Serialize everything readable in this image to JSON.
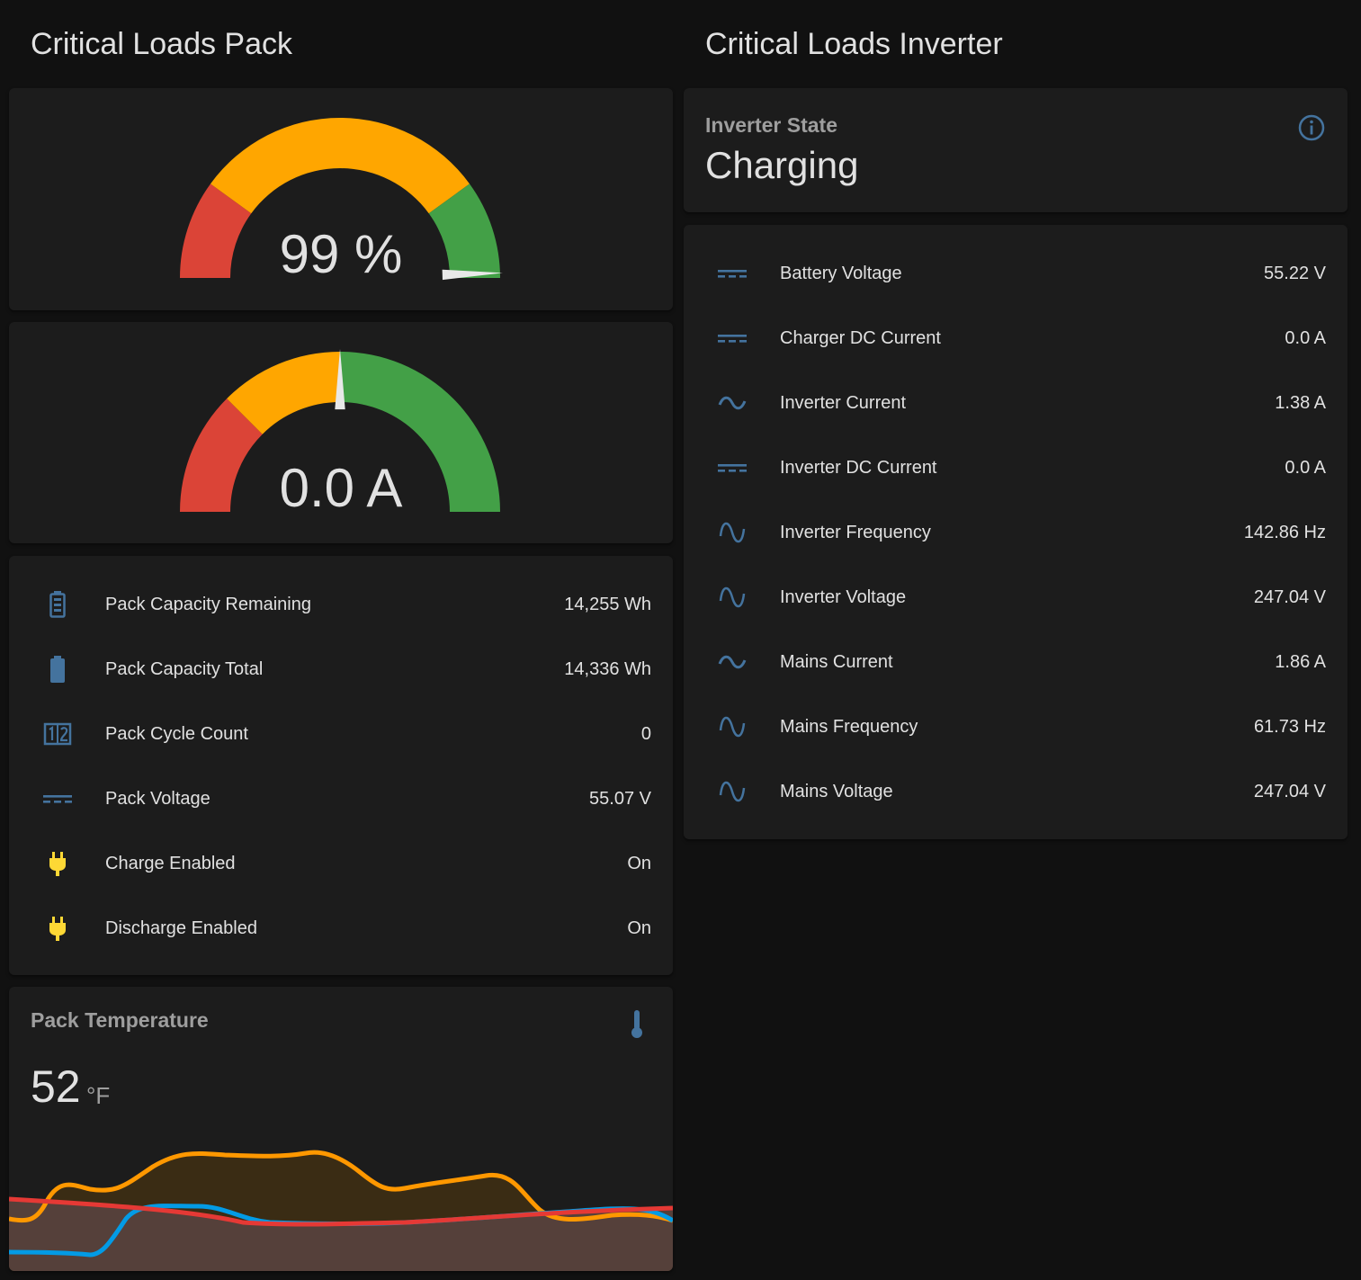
{
  "pack": {
    "title": "Critical Loads Pack",
    "soc_gauge": {
      "value_text": "99 %",
      "value": 99,
      "min": 0,
      "max": 100,
      "segments": [
        {
          "from": 0,
          "to": 20,
          "color": "#db4437"
        },
        {
          "from": 20,
          "to": 80,
          "color": "#ffa600"
        },
        {
          "from": 80,
          "to": 100,
          "color": "#43a047"
        }
      ]
    },
    "current_gauge": {
      "value_text": "0.0 A",
      "value": 0.0,
      "min": -100,
      "max": 100,
      "segments": [
        {
          "from": -100,
          "to": -50,
          "color": "#db4437"
        },
        {
          "from": -50,
          "to": 0,
          "color": "#ffa600"
        },
        {
          "from": 0,
          "to": 100,
          "color": "#43a047"
        }
      ]
    },
    "entities": [
      {
        "icon": "battery-high-icon",
        "label": "Pack Capacity Remaining",
        "value": "14,255 Wh"
      },
      {
        "icon": "battery-icon",
        "label": "Pack Capacity Total",
        "value": "14,336 Wh"
      },
      {
        "icon": "counter-icon",
        "label": "Pack Cycle Count",
        "value": "0"
      },
      {
        "icon": "current-dc-icon",
        "label": "Pack Voltage",
        "value": "55.07 V"
      },
      {
        "icon": "power-plug-icon",
        "label": "Charge Enabled",
        "value": "On"
      },
      {
        "icon": "power-plug-icon",
        "label": "Discharge Enabled",
        "value": "On"
      }
    ],
    "temperature": {
      "title": "Pack Temperature",
      "value": "52",
      "unit": "°F",
      "icon": "thermometer-icon"
    }
  },
  "inverter": {
    "title": "Critical Loads Inverter",
    "state": {
      "label": "Inverter State",
      "value": "Charging",
      "icon": "info-icon"
    },
    "entities": [
      {
        "icon": "current-dc-icon",
        "label": "Battery Voltage",
        "value": "55.22 V"
      },
      {
        "icon": "current-dc-icon",
        "label": "Charger DC Current",
        "value": "0.0 A"
      },
      {
        "icon": "current-ac-icon",
        "label": "Inverter Current",
        "value": "1.38 A"
      },
      {
        "icon": "current-dc-icon",
        "label": "Inverter DC Current",
        "value": "0.0 A"
      },
      {
        "icon": "sine-wave-icon",
        "label": "Inverter Frequency",
        "value": "142.86 Hz"
      },
      {
        "icon": "sine-wave-icon",
        "label": "Inverter Voltage",
        "value": "247.04 V"
      },
      {
        "icon": "current-ac-icon",
        "label": "Mains Current",
        "value": "1.86 A"
      },
      {
        "icon": "sine-wave-icon",
        "label": "Mains Frequency",
        "value": "61.73 Hz"
      },
      {
        "icon": "sine-wave-icon",
        "label": "Mains Voltage",
        "value": "247.04 V"
      }
    ]
  },
  "colors": {
    "icon": "#44739e",
    "plug": "#fdd835",
    "background": "#111111",
    "card": "#1c1c1c"
  }
}
